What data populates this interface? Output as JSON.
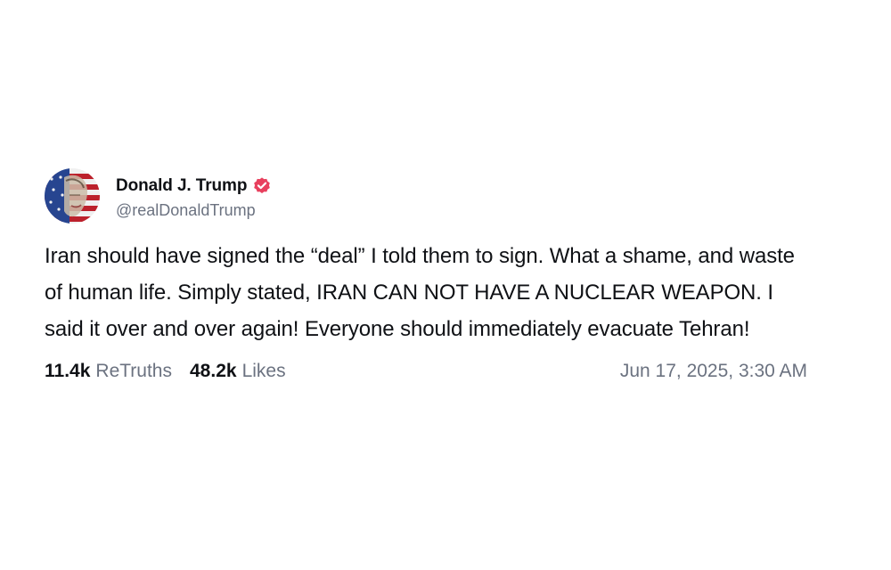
{
  "post": {
    "author": {
      "display_name": "Donald J. Trump",
      "handle": "@realDonaldTrump",
      "verified": true,
      "avatar_icon": "flag-portrait-avatar",
      "verified_color": "#e8405e"
    },
    "text": "Iran should have signed the “deal” I told them to sign. What a shame, and waste of human life. Simply stated, IRAN CAN NOT HAVE A NUCLEAR WEAPON. I said it over and over again! Everyone should immediately evacuate Tehran!",
    "stats": {
      "retruths_count": "11.4k",
      "retruths_label": "ReTruths",
      "likes_count": "48.2k",
      "likes_label": "Likes"
    },
    "timestamp": "Jun 17, 2025, 3:30 AM"
  }
}
